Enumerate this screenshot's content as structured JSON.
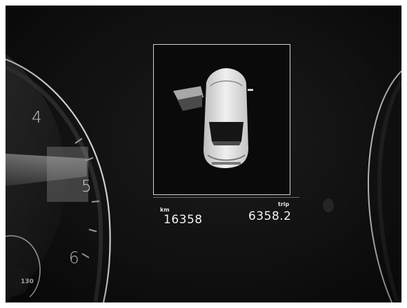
{
  "gauge": {
    "mark_4": "4",
    "mark_5": "5",
    "mark_6": "6",
    "speed_130": "130"
  },
  "display": {
    "odometer_unit": "km",
    "odometer_value": "16358",
    "trip_unit": "trip",
    "trip_value": "6358.2",
    "door_status": "rear-left-door-open"
  }
}
